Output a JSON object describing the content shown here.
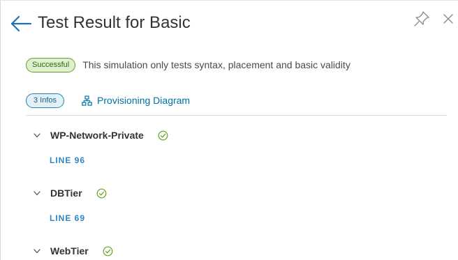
{
  "header": {
    "title": "Test Result for Basic",
    "back_icon": "arrow-left-icon",
    "pin_icon": "pin-icon",
    "close_icon": "close-icon"
  },
  "status": {
    "badge": "Successful",
    "message": "This simulation only tests syntax, placement and basic validity"
  },
  "info": {
    "badge": "3 Infos",
    "diagram_link": "Provisioning Diagram",
    "diagram_icon": "network-diagram-icon"
  },
  "resources": [
    {
      "name": "WP-Network-Private",
      "line": "LINE 96",
      "status_icon": "check-circle-icon"
    },
    {
      "name": "DBTier",
      "line": "LINE 69",
      "status_icon": "check-circle-icon"
    },
    {
      "name": "WebTier",
      "status_icon": "check-circle-icon"
    }
  ],
  "colors": {
    "success_border": "#62a420",
    "success_fill": "#dff0d0",
    "info_border": "#2b7db8",
    "link": "#0072a3",
    "line_link": "#2f86c0",
    "check": "#62a420"
  }
}
